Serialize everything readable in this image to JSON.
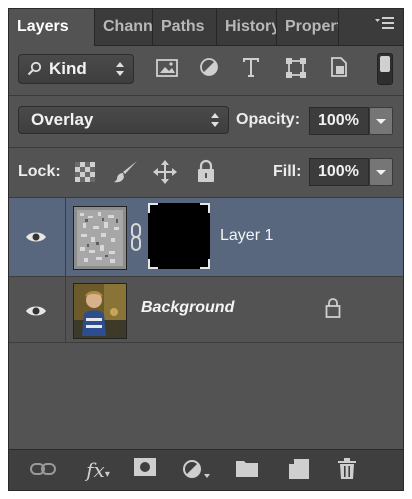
{
  "tabs": [
    {
      "label": "Layers",
      "active": true
    },
    {
      "label": "Channels",
      "active": false
    },
    {
      "label": "Paths",
      "active": false
    },
    {
      "label": "History",
      "active": false
    },
    {
      "label": "Properties",
      "active": false
    }
  ],
  "filter": {
    "kind_label": "Kind",
    "icons": [
      "pixel-filter-icon",
      "adjustment-filter-icon",
      "type-filter-icon",
      "shape-filter-icon",
      "smart-object-filter-icon"
    ]
  },
  "blend": {
    "mode": "Overlay",
    "opacity_label": "Opacity:",
    "opacity_value": "100%"
  },
  "lock": {
    "label": "Lock:",
    "fill_label": "Fill:",
    "fill_value": "100%"
  },
  "layers": [
    {
      "name": "Layer 1",
      "visible": true,
      "selected": true,
      "has_mask": true
    },
    {
      "name": "Background",
      "visible": true,
      "selected": false,
      "locked": true
    }
  ],
  "colors": {
    "panel_bg": "#535353",
    "selected_row": "#58677e",
    "tab_bar": "#3b3b3b"
  }
}
